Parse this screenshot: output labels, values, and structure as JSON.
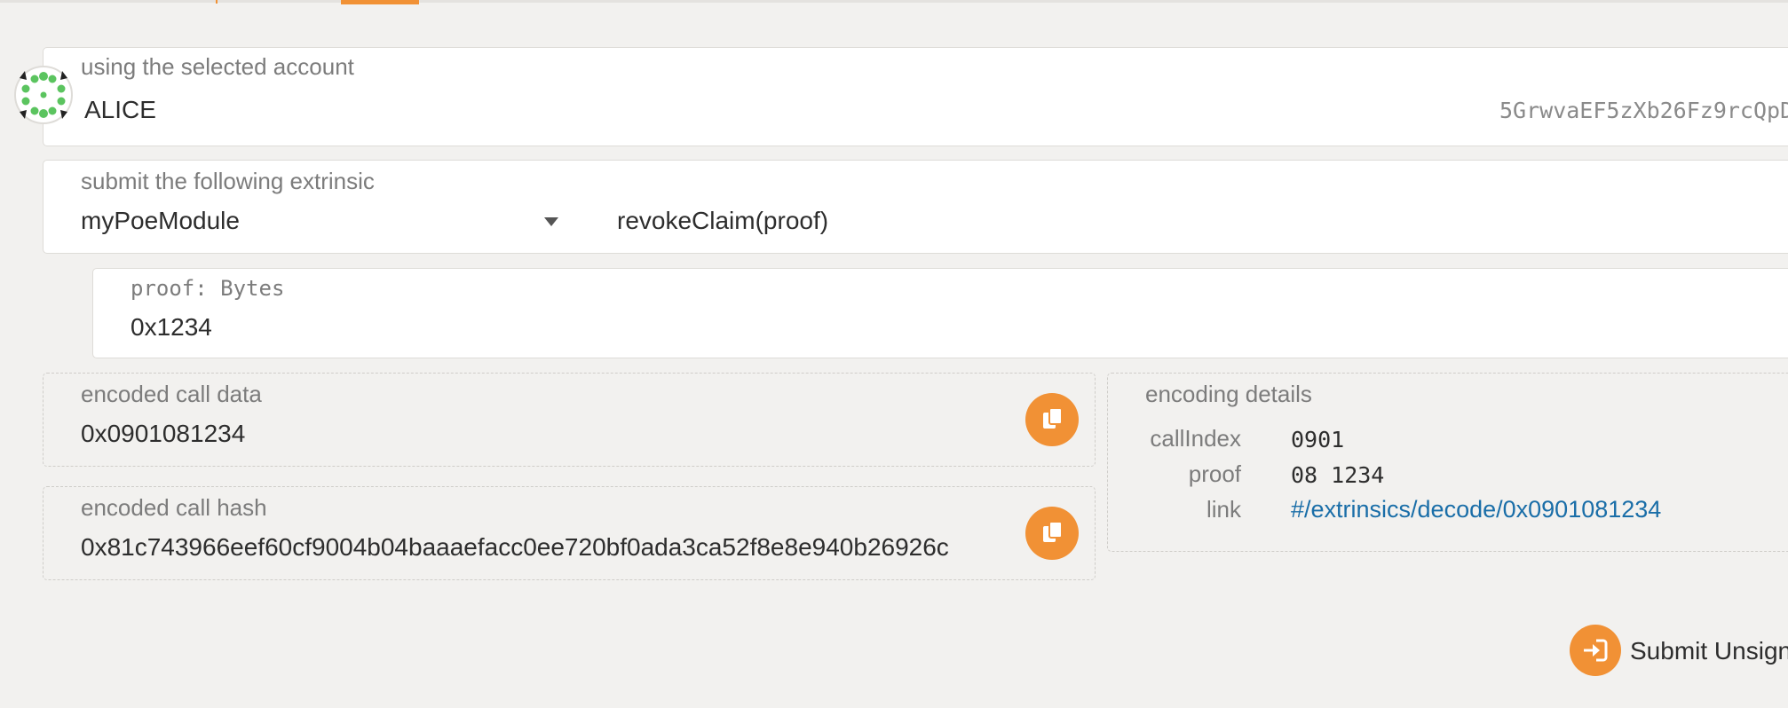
{
  "account": {
    "label": "using the selected account",
    "name": "ALICE",
    "address": "5GrwvaEF5zXb26Fz9rcQpD"
  },
  "extrinsic": {
    "label": "submit the following extrinsic",
    "module": "myPoeModule",
    "method": "revokeClaim(proof)"
  },
  "param": {
    "label": "proof: Bytes",
    "value": "0x1234"
  },
  "encoded_call_data": {
    "label": "encoded call data",
    "value": "0x0901081234"
  },
  "encoded_call_hash": {
    "label": "encoded call hash",
    "value": "0x81c743966eef60cf9004b04baaaefacc0ee720bf0ada3ca52f8e8e940b26926c"
  },
  "encoding_details": {
    "label": "encoding details",
    "rows": [
      {
        "key": "callIndex",
        "value": "0901"
      },
      {
        "key": "proof",
        "value": "08 1234"
      },
      {
        "key": "link",
        "value": "#/extrinsics/decode/0x0901081234"
      }
    ]
  },
  "submit": {
    "label": "Submit Unsign"
  },
  "colors": {
    "accent": "#f19135",
    "link": "#1a6ea8",
    "background": "#f2f1ef"
  }
}
